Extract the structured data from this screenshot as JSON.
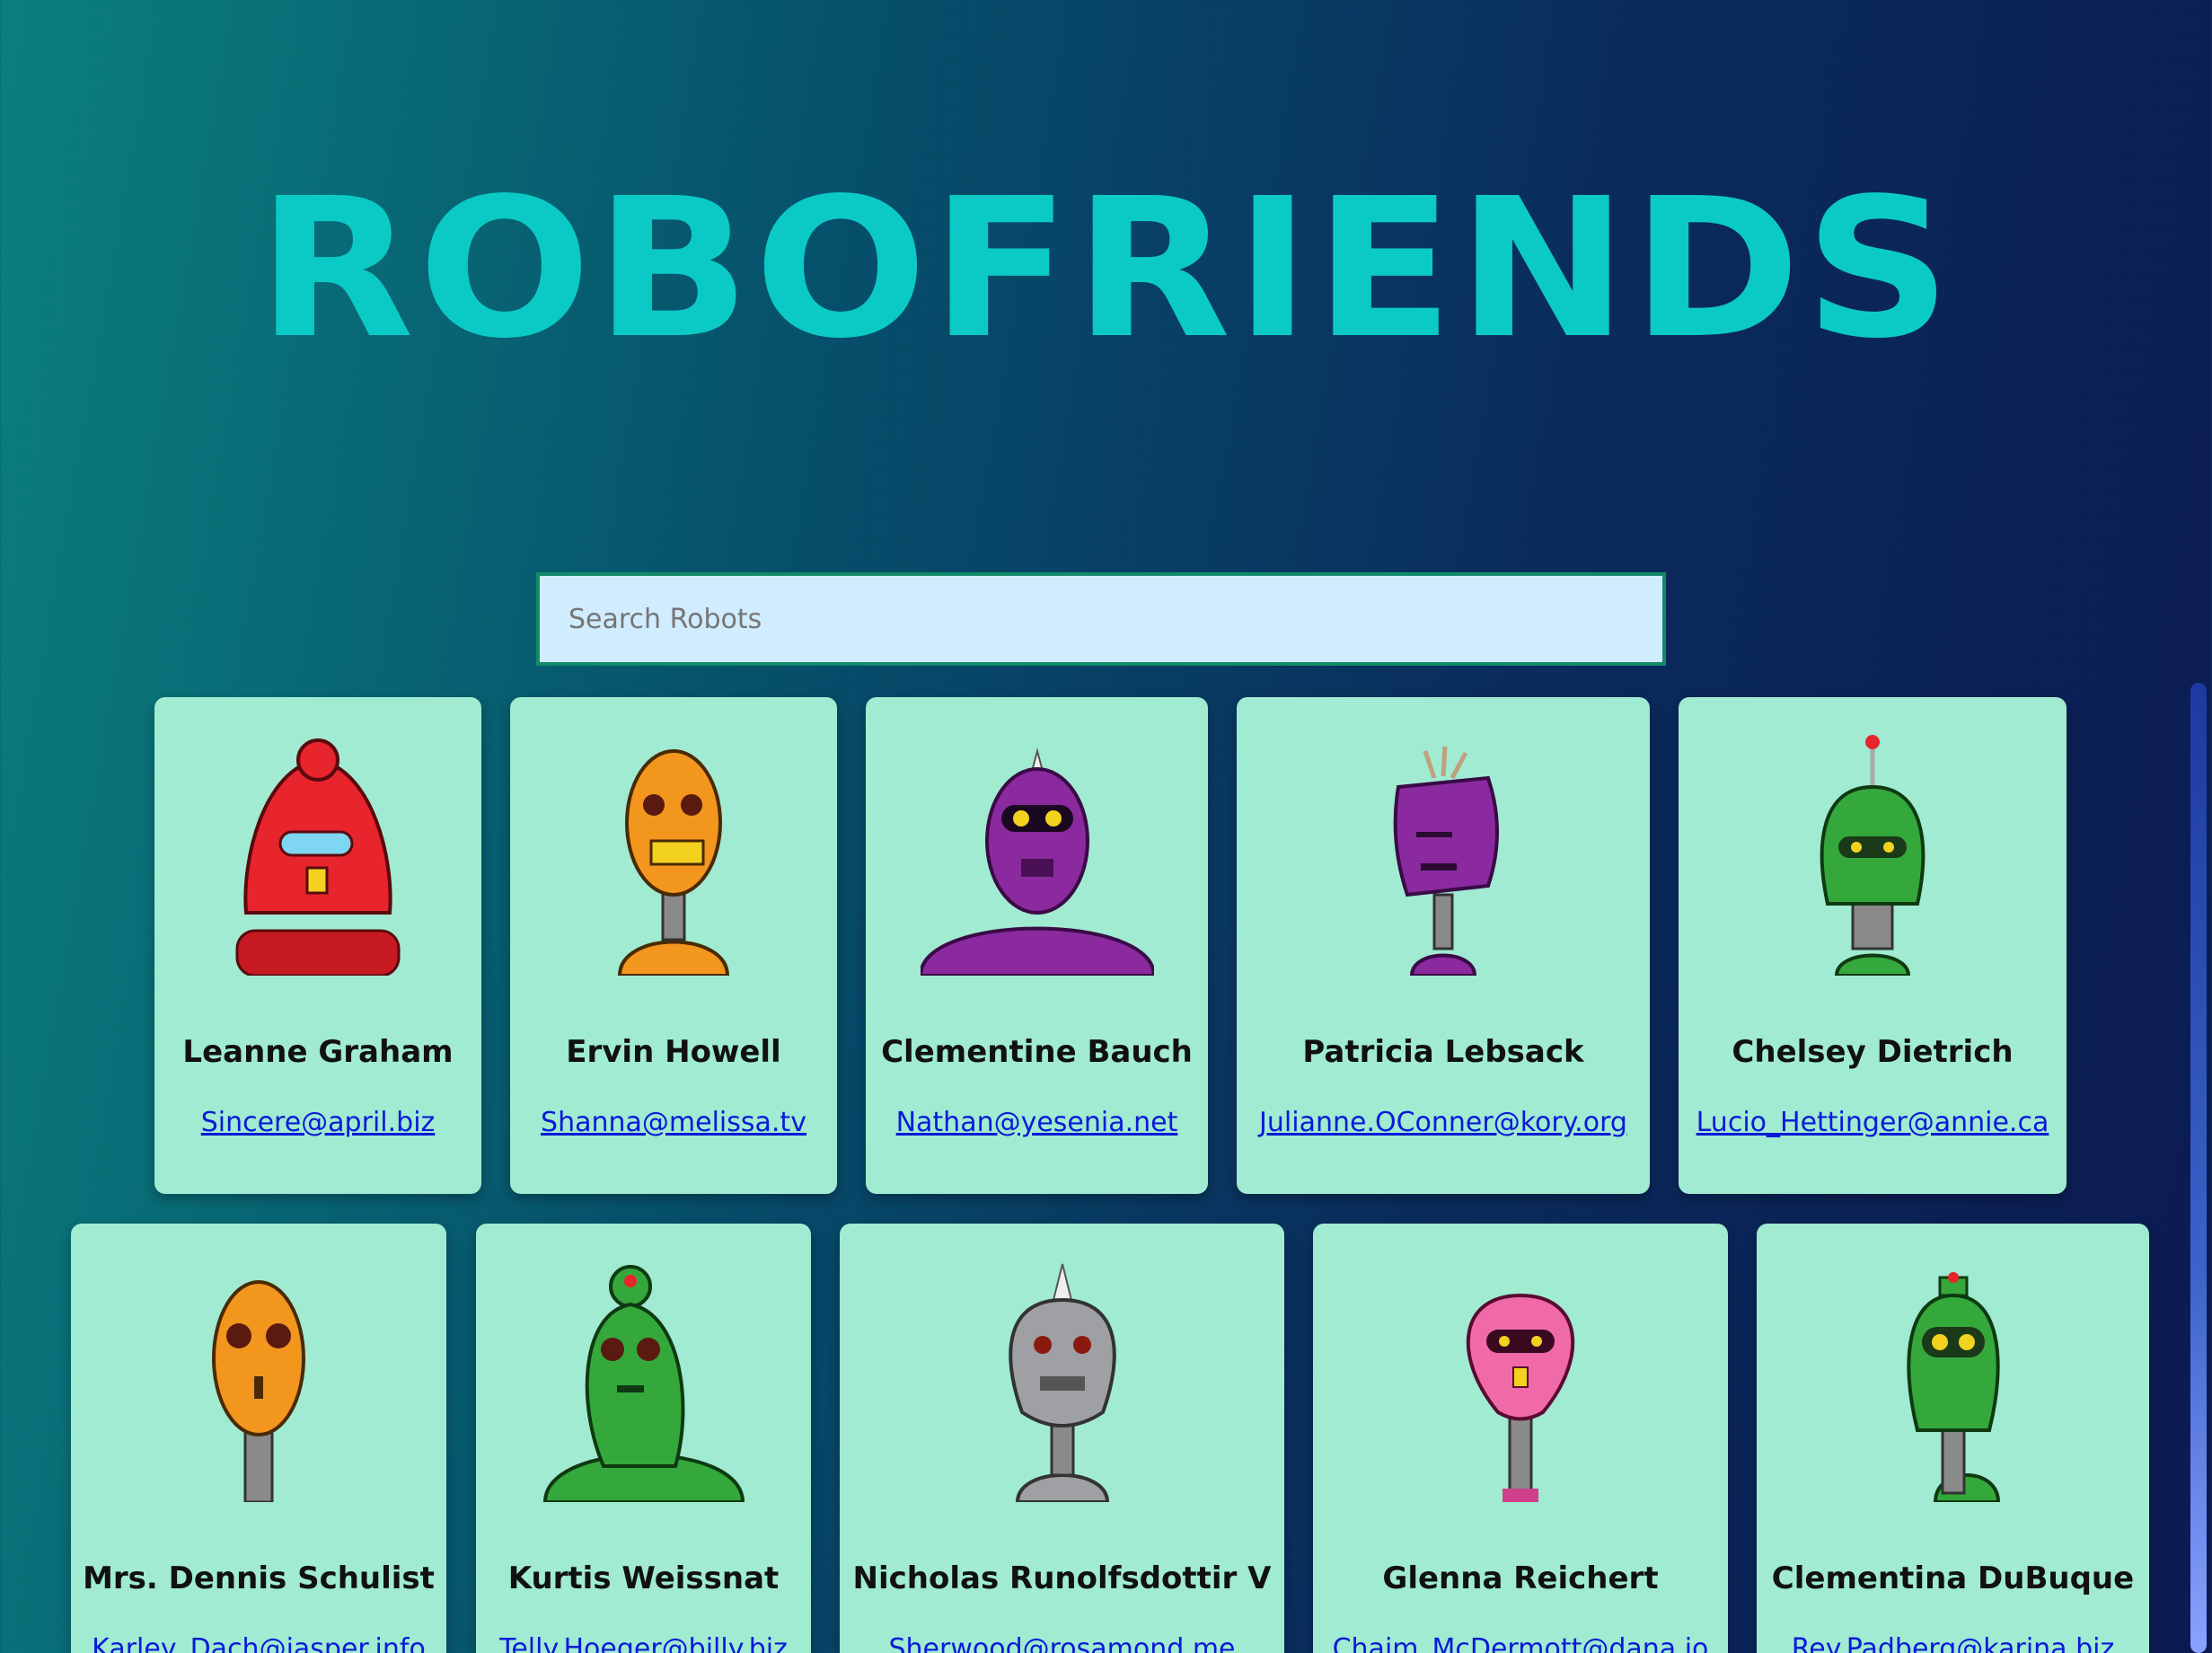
{
  "app": {
    "title": "ROBOFRIENDS"
  },
  "search": {
    "placeholder": "Search Robots",
    "value": ""
  },
  "robots": [
    {
      "name": "Leanne Graham",
      "email": "Sincere@april.biz",
      "color": "#e8242c",
      "icon": "red-robot"
    },
    {
      "name": "Ervin Howell",
      "email": "Shanna@melissa.tv",
      "color": "#f2961e",
      "icon": "orange-robot"
    },
    {
      "name": "Clementine Bauch",
      "email": "Nathan@yesenia.net",
      "color": "#8a2a9e",
      "icon": "purple-robot"
    },
    {
      "name": "Patricia Lebsack",
      "email": "Julianne.OConner@kory.org",
      "color": "#8a2a9e",
      "icon": "purple-robot"
    },
    {
      "name": "Chelsey Dietrich",
      "email": "Lucio_Hettinger@annie.ca",
      "color": "#35a83c",
      "icon": "green-robot"
    },
    {
      "name": "Mrs. Dennis Schulist",
      "email": "Karley_Dach@jasper.info",
      "color": "#f2961e",
      "icon": "orange-robot"
    },
    {
      "name": "Kurtis Weissnat",
      "email": "Telly.Hoeger@billy.biz",
      "color": "#35a83c",
      "icon": "green-robot"
    },
    {
      "name": "Nicholas Runolfsdottir V",
      "email": "Sherwood@rosamond.me",
      "color": "#9ea0a4",
      "icon": "gray-robot"
    },
    {
      "name": "Glenna Reichert",
      "email": "Chaim_McDermott@dana.io",
      "color": "#f06aa8",
      "icon": "pink-robot"
    },
    {
      "name": "Clementina DuBuque",
      "email": "Rey.Padberg@karina.biz",
      "color": "#35a83c",
      "icon": "green-robot"
    }
  ],
  "colors": {
    "title": "#0bcac6",
    "card": "#a0ebd1",
    "link": "#0a1ad8",
    "search_bg": "#d0ecff",
    "search_border": "#128a69"
  }
}
